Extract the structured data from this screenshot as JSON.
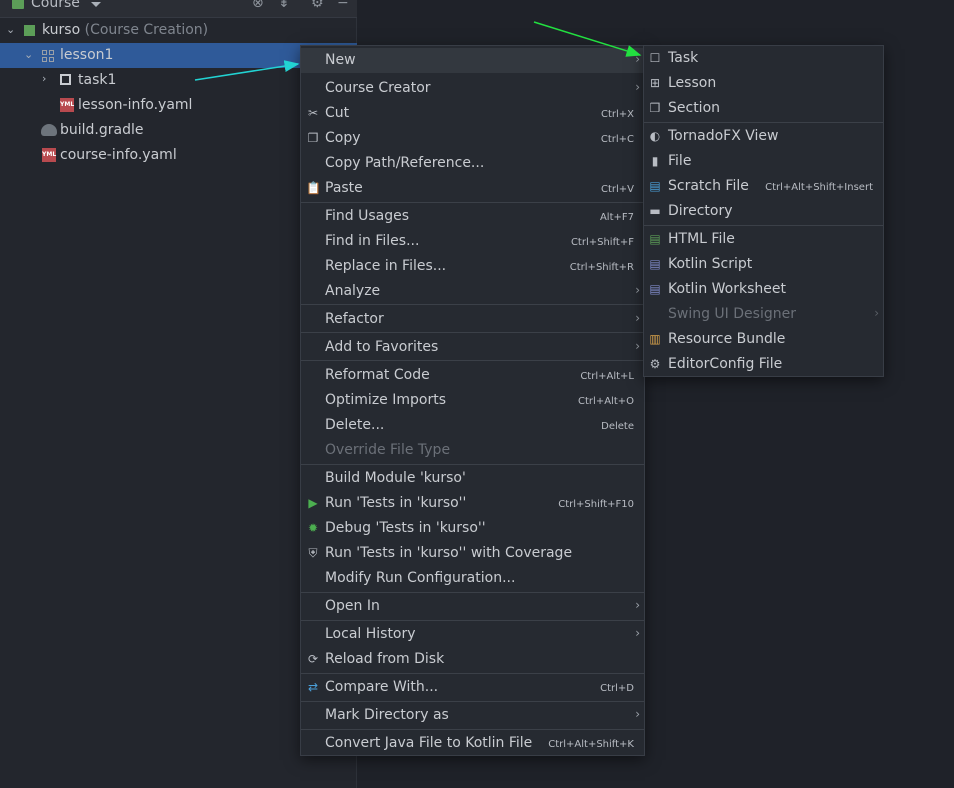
{
  "panel": {
    "title": "Course",
    "tree": [
      {
        "label": "kurso",
        "suffix": " (Course Creation)"
      },
      {
        "label": "lesson1"
      },
      {
        "label": "task1"
      },
      {
        "label": "lesson-info.yaml"
      },
      {
        "label": "build.gradle"
      },
      {
        "label": "course-info.yaml"
      }
    ]
  },
  "context_menu": {
    "items": [
      {
        "label": "New",
        "shortcut": "",
        "submenu": true
      },
      {
        "label": "Course Creator",
        "shortcut": "",
        "submenu": true
      },
      {
        "label": "Cut",
        "shortcut": "Ctrl+X"
      },
      {
        "label": "Copy",
        "shortcut": "Ctrl+C"
      },
      {
        "label": "Copy Path/Reference...",
        "shortcut": ""
      },
      {
        "label": "Paste",
        "shortcut": "Ctrl+V"
      },
      {
        "label": "Find Usages",
        "shortcut": "Alt+F7"
      },
      {
        "label": "Find in Files...",
        "shortcut": "Ctrl+Shift+F"
      },
      {
        "label": "Replace in Files...",
        "shortcut": "Ctrl+Shift+R"
      },
      {
        "label": "Analyze",
        "shortcut": "",
        "submenu": true
      },
      {
        "label": "Refactor",
        "shortcut": "",
        "submenu": true
      },
      {
        "label": "Add to Favorites",
        "shortcut": "",
        "submenu": true
      },
      {
        "label": "Reformat Code",
        "shortcut": "Ctrl+Alt+L"
      },
      {
        "label": "Optimize Imports",
        "shortcut": "Ctrl+Alt+O"
      },
      {
        "label": "Delete...",
        "shortcut": "Delete"
      },
      {
        "label": "Override File Type",
        "shortcut": "",
        "disabled": true
      },
      {
        "label": "Build Module 'kurso'",
        "shortcut": ""
      },
      {
        "label": "Run 'Tests in 'kurso''",
        "shortcut": "Ctrl+Shift+F10"
      },
      {
        "label": "Debug 'Tests in 'kurso''",
        "shortcut": ""
      },
      {
        "label": "Run 'Tests in 'kurso'' with Coverage",
        "shortcut": ""
      },
      {
        "label": "Modify Run Configuration...",
        "shortcut": ""
      },
      {
        "label": "Open In",
        "shortcut": "",
        "submenu": true
      },
      {
        "label": "Local History",
        "shortcut": "",
        "submenu": true
      },
      {
        "label": "Reload from Disk",
        "shortcut": ""
      },
      {
        "label": "Compare With...",
        "shortcut": "Ctrl+D"
      },
      {
        "label": "Mark Directory as",
        "shortcut": "",
        "submenu": true
      },
      {
        "label": "Convert Java File to Kotlin File",
        "shortcut": "Ctrl+Alt+Shift+K"
      }
    ]
  },
  "new_submenu": {
    "items": [
      {
        "label": "Task",
        "icon": "task-icon"
      },
      {
        "label": "Lesson",
        "icon": "lesson-icon"
      },
      {
        "label": "Section",
        "icon": "section-icon"
      },
      {
        "label": "TornadoFX View",
        "icon": "tornadofx-icon"
      },
      {
        "label": "File",
        "icon": "file-icon"
      },
      {
        "label": "Scratch File",
        "icon": "scratch-file-icon",
        "shortcut": "Ctrl+Alt+Shift+Insert"
      },
      {
        "label": "Directory",
        "icon": "folder-icon"
      },
      {
        "label": "HTML File",
        "icon": "html-file-icon"
      },
      {
        "label": "Kotlin Script",
        "icon": "kotlin-script-icon"
      },
      {
        "label": "Kotlin Worksheet",
        "icon": "kotlin-worksheet-icon"
      },
      {
        "label": "Swing UI Designer",
        "icon": "",
        "disabled": true,
        "submenu": true
      },
      {
        "label": "Resource Bundle",
        "icon": "resource-bundle-icon"
      },
      {
        "label": "EditorConfig File",
        "icon": "gear-icon"
      }
    ]
  },
  "colors": {
    "selection": "#2f5a99",
    "background": "#1f2229",
    "menu": "#262a31",
    "arrow_green": "#22e040",
    "arrow_cyan": "#22d3d3"
  }
}
